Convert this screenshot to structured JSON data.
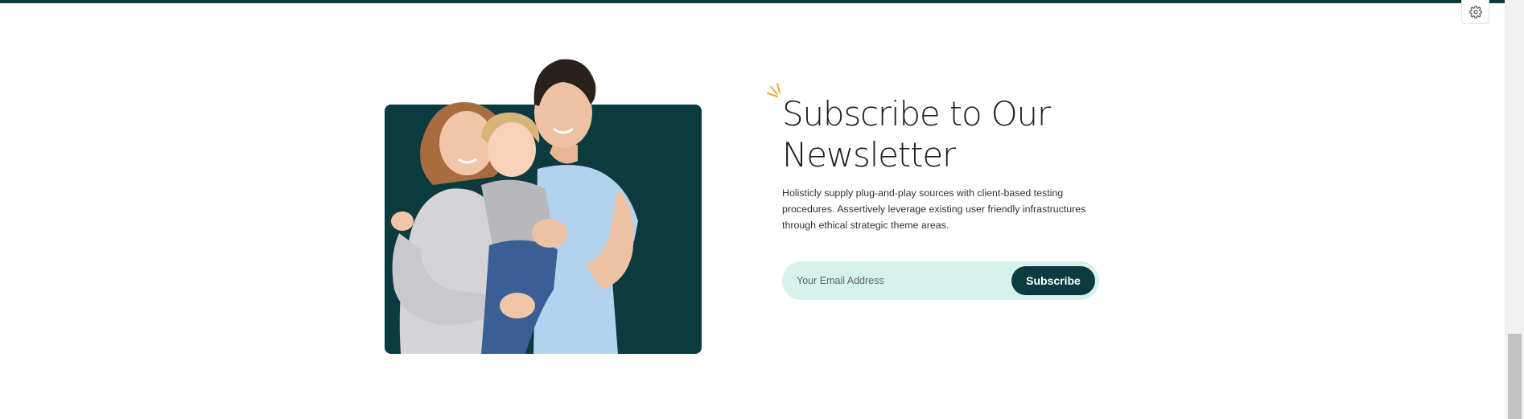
{
  "newsletter": {
    "title_line1": "Subscribe to Our",
    "title_line2": "Newsletter",
    "description": "Holisticly supply plug-and-play sources with client-based testing procedures. Assertively leverage existing user friendly infrastructures through ethical strategic theme areas.",
    "email_placeholder": "Your Email Address",
    "subscribe_label": "Subscribe"
  },
  "image": {
    "alt": "family-photo"
  },
  "icons": {
    "settings": "gear-icon",
    "decoration": "sparkle-icon"
  },
  "colors": {
    "brand_dark": "#0b3b3e",
    "input_bg": "#d5f2ec",
    "sparkle": "#f2a93b",
    "heading": "#1c2120"
  }
}
